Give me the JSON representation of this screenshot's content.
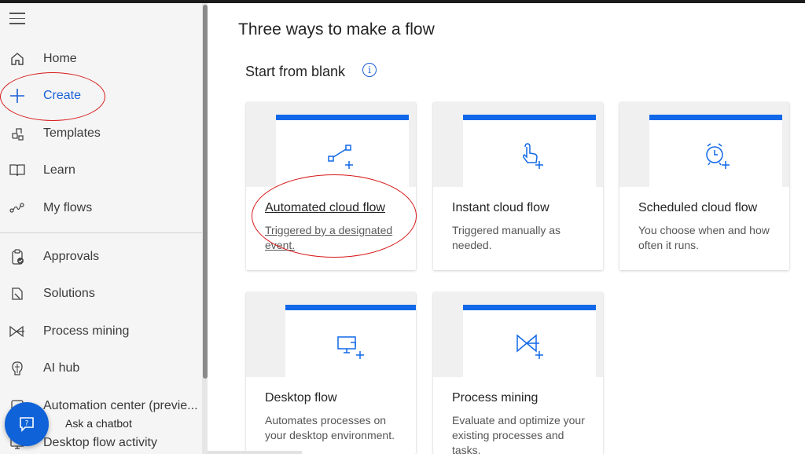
{
  "sidebar": {
    "items": [
      {
        "label": "Home",
        "icon": "home-icon"
      },
      {
        "label": "Create",
        "icon": "plus-icon"
      },
      {
        "label": "Templates",
        "icon": "templates-icon"
      },
      {
        "label": "Learn",
        "icon": "book-icon"
      },
      {
        "label": "My flows",
        "icon": "flows-icon"
      },
      {
        "label": "Approvals",
        "icon": "approvals-icon"
      },
      {
        "label": "Solutions",
        "icon": "solutions-icon"
      },
      {
        "label": "Process mining",
        "icon": "process-mining-icon"
      },
      {
        "label": "AI hub",
        "icon": "ai-hub-icon"
      },
      {
        "label": "Automation center (previe...",
        "icon": "automation-center-icon"
      },
      {
        "label": "Desktop flow activity",
        "icon": "desktop-activity-icon"
      }
    ],
    "active": "Create"
  },
  "chatbot": {
    "label": "Ask a chatbot",
    "icon": "chat-help-icon"
  },
  "main": {
    "title": "Three ways to make a flow",
    "section_title": "Start from blank",
    "cards": [
      {
        "title": "Automated cloud flow",
        "desc": "Triggered by a designated event.",
        "icon": "automated-flow-icon"
      },
      {
        "title": "Instant cloud flow",
        "desc": "Triggered manually as needed.",
        "icon": "instant-flow-icon"
      },
      {
        "title": "Scheduled cloud flow",
        "desc": "You choose when and how often it runs.",
        "icon": "scheduled-flow-icon"
      },
      {
        "title": "Desktop flow",
        "desc": "Automates processes on your desktop environment.",
        "icon": "desktop-flow-icon"
      },
      {
        "title": "Process mining",
        "desc": "Evaluate and optimize your existing processes and tasks.",
        "icon": "process-mining-card-icon"
      }
    ]
  },
  "colors": {
    "accent": "#1068e8",
    "active_nav": "#1a5fd6",
    "annotation": "#d71b1b",
    "chatbot": "#0f62d8"
  }
}
